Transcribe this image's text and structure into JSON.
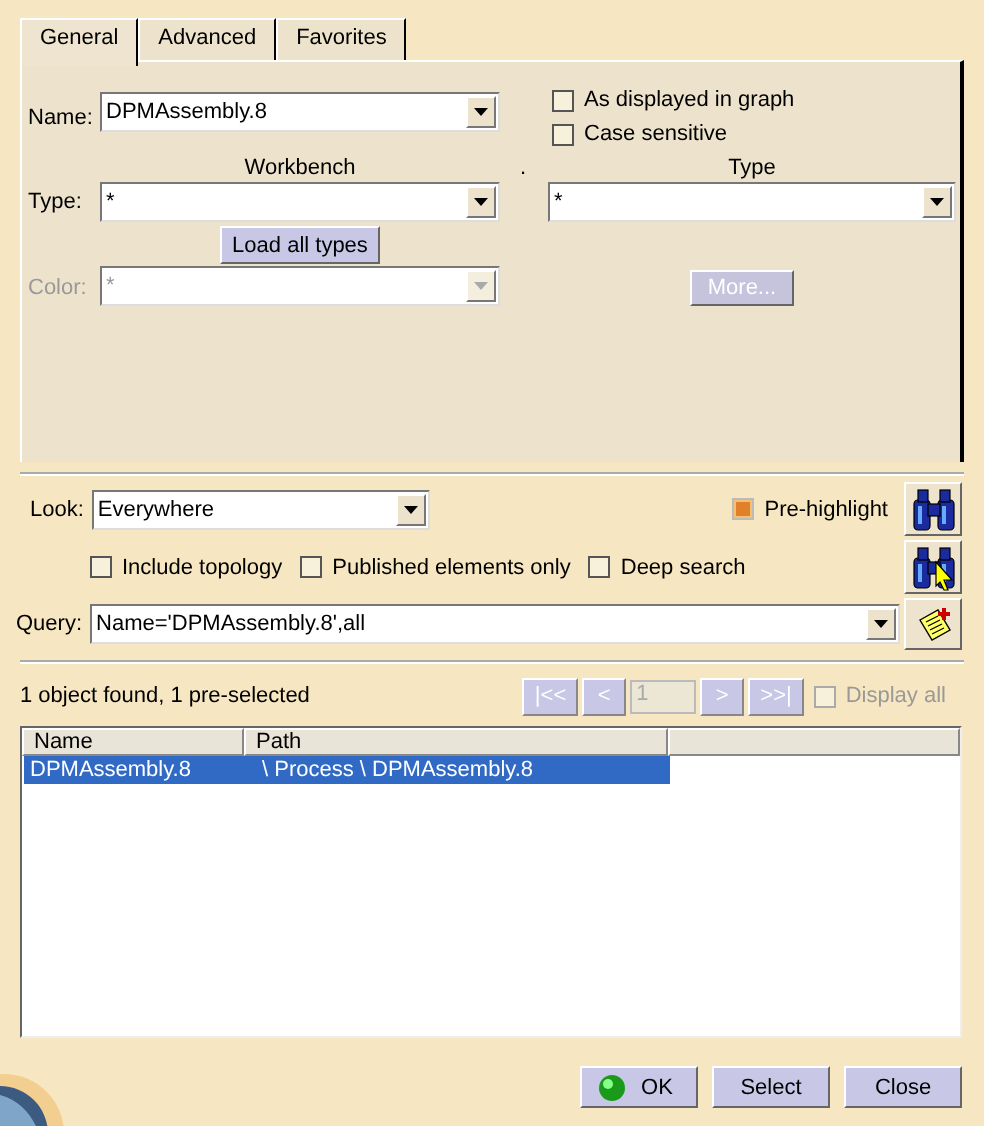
{
  "tabs": [
    {
      "label": "General",
      "selected": true
    },
    {
      "label": "Advanced",
      "selected": false
    },
    {
      "label": "Favorites",
      "selected": false
    }
  ],
  "filter": {
    "name_label": "Name:",
    "name_value": "DPMAssembly.8",
    "checks": [
      {
        "label": "As displayed in graph",
        "checked": false
      },
      {
        "label": "Case sensitive",
        "checked": false
      }
    ],
    "workbench_header": "Workbench",
    "separator": ".",
    "type_header": "Type",
    "type_label": "Type:",
    "workbench_value": "*",
    "type_value": "*",
    "load_button": "Load all types",
    "color": {
      "label": "Color:",
      "value": "*",
      "disabled": true
    },
    "more_button": {
      "label": "More...",
      "disabled": true
    }
  },
  "look": {
    "label": "Look:",
    "value": "Everywhere"
  },
  "pre_highlight": {
    "label": "Pre-highlight",
    "checked": true
  },
  "options": [
    {
      "label": "Include topology",
      "checked": false
    },
    {
      "label": "Published elements only",
      "checked": false
    },
    {
      "label": "Deep search",
      "checked": false
    }
  ],
  "query": {
    "label": "Query:",
    "value": "Name='DPMAssembly.8',all"
  },
  "status": "1 object found, 1 pre-selected",
  "pager": {
    "buttons": [
      {
        "label": "|<<",
        "disabled": true
      },
      {
        "label": "<",
        "disabled": true
      }
    ],
    "page": "1",
    "buttons_after": [
      {
        "label": ">",
        "disabled": true
      },
      {
        "label": ">>|",
        "disabled": true
      }
    ],
    "display_all": {
      "label": "Display all",
      "checked": false,
      "disabled": true
    }
  },
  "table": {
    "columns": [
      "Name",
      "Path"
    ],
    "rows": [
      {
        "cells": [
          "DPMAssembly.8",
          "\\ Process \\ DPMAssembly.8"
        ],
        "selected": true
      }
    ]
  },
  "buttons": [
    {
      "label": "OK",
      "kind": "ok"
    },
    {
      "label": "Select",
      "kind": "plain"
    },
    {
      "label": "Close",
      "kind": "plain"
    }
  ]
}
